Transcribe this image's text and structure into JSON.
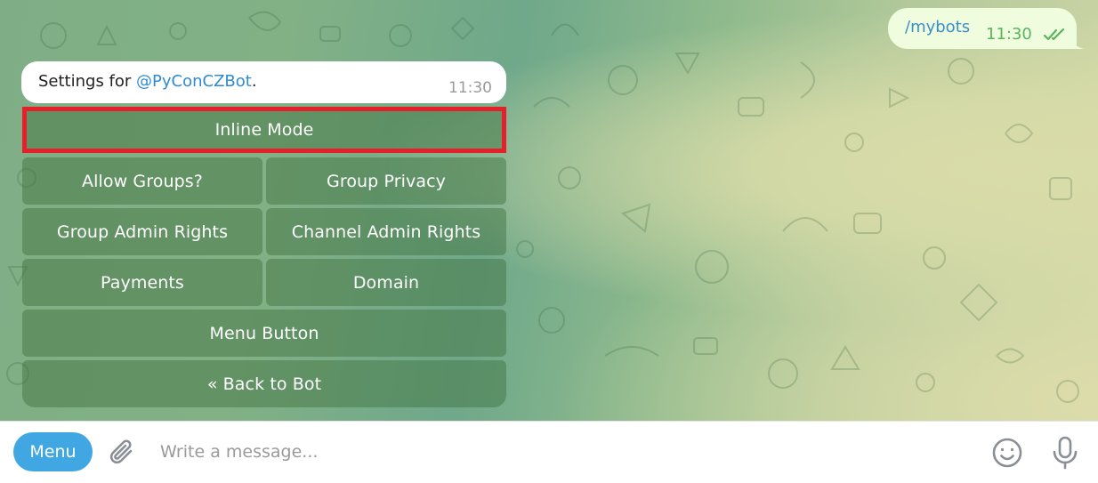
{
  "outgoing": {
    "text": "/mybots",
    "time": "11:30"
  },
  "incoming": {
    "text_prefix": "Settings for ",
    "mention": "@PyConCZBot",
    "text_suffix": ".",
    "time": "11:30"
  },
  "keyboard": {
    "inline_mode": "Inline Mode",
    "allow_groups": "Allow Groups?",
    "group_privacy": "Group Privacy",
    "group_admin_rights": "Group Admin Rights",
    "channel_admin_rights": "Channel Admin Rights",
    "payments": "Payments",
    "domain": "Domain",
    "menu_button": "Menu Button",
    "back_to_bot": "« Back to Bot"
  },
  "composer": {
    "menu_label": "Menu",
    "placeholder": "Write a message..."
  },
  "colors": {
    "menu_button": "#40a7e3",
    "highlight": "#e5202a",
    "outgoing_bubble": "#effdde",
    "mention": "#2f8bd1"
  },
  "icons": [
    "paperclip-icon",
    "emoji-icon",
    "microphone-icon",
    "double-check-icon"
  ]
}
